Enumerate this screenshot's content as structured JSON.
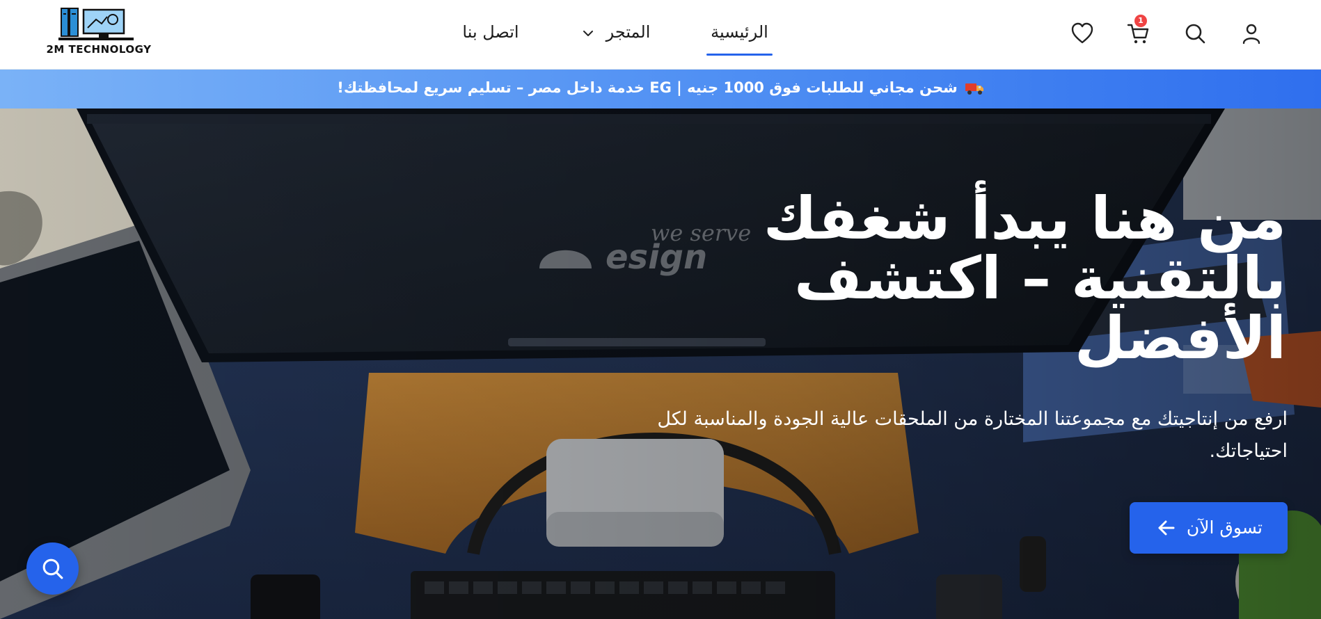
{
  "brand": {
    "name": "2M TECHNOLOGY"
  },
  "nav": {
    "home": "الرئيسية",
    "store": "المتجر",
    "contact": "اتصل بنا"
  },
  "header_icons": {
    "account": "user-icon",
    "search": "search-icon",
    "cart": "cart-icon",
    "wishlist": "heart-icon",
    "cart_count": "1"
  },
  "promo": {
    "icon": "truck-icon",
    "text": "شحن مجاني للطلبات فوق 1000 جنيه | EG خدمة داخل مصر – تسليم سريع لمحافظتك!"
  },
  "hero": {
    "title": "من هنا يبدأ شغفك بالتقنية – اكتشف الأفضل",
    "subtitle": "ارفع من إنتاجيتك مع مجموعتنا المختارة من الملحقات عالية الجودة والمناسبة لكل احتياجاتك.",
    "cta_label": "تسوق الآن",
    "screen_watermark_1": "we serve",
    "screen_watermark_2": "esign"
  },
  "colors": {
    "accent": "#2563eb",
    "badge": "#ef4444",
    "promo_start": "#7ab2f7",
    "promo_end": "#2f6fee"
  }
}
